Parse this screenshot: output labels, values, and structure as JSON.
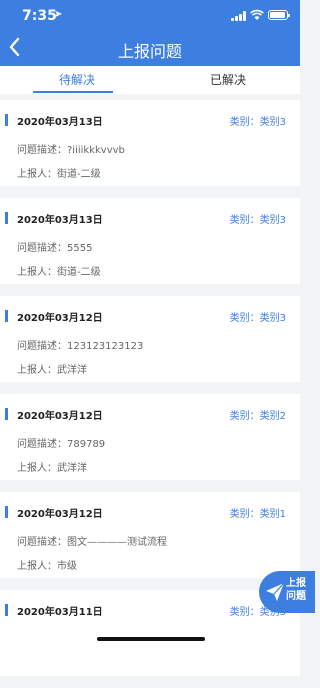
{
  "status_bar": {
    "time": "7:35",
    "location_arrow": "location-arrow-icon"
  },
  "header": {
    "title": "上报问题",
    "back_icon": "chevron-left-icon"
  },
  "tabs": [
    {
      "label": "待解决",
      "active": true
    },
    {
      "label": "已解决",
      "active": false
    }
  ],
  "items": [
    {
      "date": "2020年03月13日",
      "category": "类别：类别3",
      "description": "问题描述：?iiiikkkvvvb",
      "reporter": "上报人：街道-二级"
    },
    {
      "date": "2020年03月13日",
      "category": "类别：类别3",
      "description": "问题描述：5555",
      "reporter": "上报人：街道-二级"
    },
    {
      "date": "2020年03月12日",
      "category": "类别：类别3",
      "description": "问题描述：123123123123",
      "reporter": "上报人：武洋洋"
    },
    {
      "date": "2020年03月12日",
      "category": "类别：类别2",
      "description": "问题描述：789789",
      "reporter": "上报人：武洋洋"
    },
    {
      "date": "2020年03月12日",
      "category": "类别：类别1",
      "description": "问题描述：图文————测试流程",
      "reporter": "上报人：市级"
    },
    {
      "date": "2020年03月11日",
      "category": "类别：类别3",
      "description": "",
      "reporter": ""
    }
  ],
  "fab": {
    "label": "上报问题",
    "icon": "paper-plane-icon"
  },
  "colors": {
    "primary": "#3d7fe0",
    "background": "#f2f3f5"
  }
}
